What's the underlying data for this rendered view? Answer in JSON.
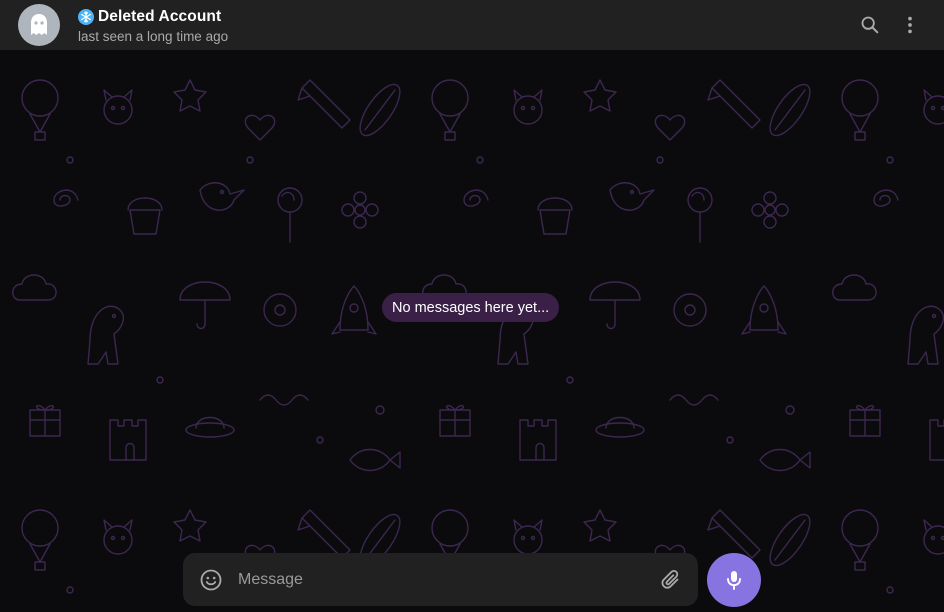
{
  "header": {
    "title": "Deleted Account",
    "status": "last seen a long time ago",
    "avatar_icon": "ghost-icon",
    "badge_icon": "snowflake-icon",
    "actions": [
      "search-icon",
      "more-vertical-icon"
    ]
  },
  "chat": {
    "empty_text": "No messages here yet..."
  },
  "composer": {
    "placeholder": "Message",
    "value": "",
    "emoji_icon": "emoji-icon",
    "attach_icon": "paperclip-icon",
    "send_icon": "microphone-icon"
  },
  "colors": {
    "header_bg": "#212121",
    "chat_bg": "#0b0a0d",
    "pattern_stroke": "#3c2750",
    "pill_bg": "#3a2046",
    "accent": "#8774e1",
    "snowflake": "#4fb4f4",
    "avatar_bg": "#aeb5bd"
  }
}
